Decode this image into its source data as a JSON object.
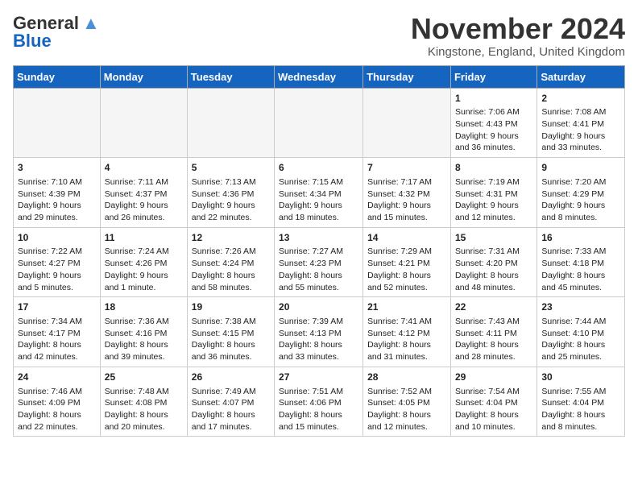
{
  "logo": {
    "general": "General",
    "blue": "Blue"
  },
  "title": "November 2024",
  "location": "Kingstone, England, United Kingdom",
  "days_of_week": [
    "Sunday",
    "Monday",
    "Tuesday",
    "Wednesday",
    "Thursday",
    "Friday",
    "Saturday"
  ],
  "weeks": [
    [
      {
        "day": "",
        "info": ""
      },
      {
        "day": "",
        "info": ""
      },
      {
        "day": "",
        "info": ""
      },
      {
        "day": "",
        "info": ""
      },
      {
        "day": "",
        "info": ""
      },
      {
        "day": "1",
        "info": "Sunrise: 7:06 AM\nSunset: 4:43 PM\nDaylight: 9 hours and 36 minutes."
      },
      {
        "day": "2",
        "info": "Sunrise: 7:08 AM\nSunset: 4:41 PM\nDaylight: 9 hours and 33 minutes."
      }
    ],
    [
      {
        "day": "3",
        "info": "Sunrise: 7:10 AM\nSunset: 4:39 PM\nDaylight: 9 hours and 29 minutes."
      },
      {
        "day": "4",
        "info": "Sunrise: 7:11 AM\nSunset: 4:37 PM\nDaylight: 9 hours and 26 minutes."
      },
      {
        "day": "5",
        "info": "Sunrise: 7:13 AM\nSunset: 4:36 PM\nDaylight: 9 hours and 22 minutes."
      },
      {
        "day": "6",
        "info": "Sunrise: 7:15 AM\nSunset: 4:34 PM\nDaylight: 9 hours and 18 minutes."
      },
      {
        "day": "7",
        "info": "Sunrise: 7:17 AM\nSunset: 4:32 PM\nDaylight: 9 hours and 15 minutes."
      },
      {
        "day": "8",
        "info": "Sunrise: 7:19 AM\nSunset: 4:31 PM\nDaylight: 9 hours and 12 minutes."
      },
      {
        "day": "9",
        "info": "Sunrise: 7:20 AM\nSunset: 4:29 PM\nDaylight: 9 hours and 8 minutes."
      }
    ],
    [
      {
        "day": "10",
        "info": "Sunrise: 7:22 AM\nSunset: 4:27 PM\nDaylight: 9 hours and 5 minutes."
      },
      {
        "day": "11",
        "info": "Sunrise: 7:24 AM\nSunset: 4:26 PM\nDaylight: 9 hours and 1 minute."
      },
      {
        "day": "12",
        "info": "Sunrise: 7:26 AM\nSunset: 4:24 PM\nDaylight: 8 hours and 58 minutes."
      },
      {
        "day": "13",
        "info": "Sunrise: 7:27 AM\nSunset: 4:23 PM\nDaylight: 8 hours and 55 minutes."
      },
      {
        "day": "14",
        "info": "Sunrise: 7:29 AM\nSunset: 4:21 PM\nDaylight: 8 hours and 52 minutes."
      },
      {
        "day": "15",
        "info": "Sunrise: 7:31 AM\nSunset: 4:20 PM\nDaylight: 8 hours and 48 minutes."
      },
      {
        "day": "16",
        "info": "Sunrise: 7:33 AM\nSunset: 4:18 PM\nDaylight: 8 hours and 45 minutes."
      }
    ],
    [
      {
        "day": "17",
        "info": "Sunrise: 7:34 AM\nSunset: 4:17 PM\nDaylight: 8 hours and 42 minutes."
      },
      {
        "day": "18",
        "info": "Sunrise: 7:36 AM\nSunset: 4:16 PM\nDaylight: 8 hours and 39 minutes."
      },
      {
        "day": "19",
        "info": "Sunrise: 7:38 AM\nSunset: 4:15 PM\nDaylight: 8 hours and 36 minutes."
      },
      {
        "day": "20",
        "info": "Sunrise: 7:39 AM\nSunset: 4:13 PM\nDaylight: 8 hours and 33 minutes."
      },
      {
        "day": "21",
        "info": "Sunrise: 7:41 AM\nSunset: 4:12 PM\nDaylight: 8 hours and 31 minutes."
      },
      {
        "day": "22",
        "info": "Sunrise: 7:43 AM\nSunset: 4:11 PM\nDaylight: 8 hours and 28 minutes."
      },
      {
        "day": "23",
        "info": "Sunrise: 7:44 AM\nSunset: 4:10 PM\nDaylight: 8 hours and 25 minutes."
      }
    ],
    [
      {
        "day": "24",
        "info": "Sunrise: 7:46 AM\nSunset: 4:09 PM\nDaylight: 8 hours and 22 minutes."
      },
      {
        "day": "25",
        "info": "Sunrise: 7:48 AM\nSunset: 4:08 PM\nDaylight: 8 hours and 20 minutes."
      },
      {
        "day": "26",
        "info": "Sunrise: 7:49 AM\nSunset: 4:07 PM\nDaylight: 8 hours and 17 minutes."
      },
      {
        "day": "27",
        "info": "Sunrise: 7:51 AM\nSunset: 4:06 PM\nDaylight: 8 hours and 15 minutes."
      },
      {
        "day": "28",
        "info": "Sunrise: 7:52 AM\nSunset: 4:05 PM\nDaylight: 8 hours and 12 minutes."
      },
      {
        "day": "29",
        "info": "Sunrise: 7:54 AM\nSunset: 4:04 PM\nDaylight: 8 hours and 10 minutes."
      },
      {
        "day": "30",
        "info": "Sunrise: 7:55 AM\nSunset: 4:04 PM\nDaylight: 8 hours and 8 minutes."
      }
    ]
  ]
}
